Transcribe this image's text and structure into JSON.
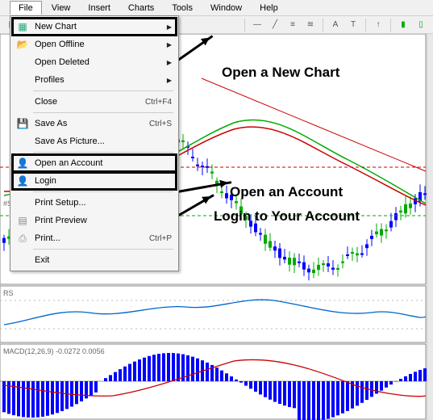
{
  "menubar": {
    "items": [
      "File",
      "View",
      "Insert",
      "Charts",
      "Tools",
      "Window",
      "Help"
    ],
    "active": 0
  },
  "file_menu": {
    "items": [
      {
        "label": "New Chart",
        "icon": "chart-plus",
        "submenu": true,
        "boxed": true
      },
      {
        "label": "Open Offline",
        "icon": "folder-open",
        "submenu": true
      },
      {
        "label": "Open Deleted",
        "submenu": true
      },
      {
        "label": "Profiles",
        "submenu": true
      },
      {
        "sep": true
      },
      {
        "label": "Close",
        "shortcut": "Ctrl+F4"
      },
      {
        "sep": true
      },
      {
        "label": "Save As",
        "icon": "save",
        "shortcut": "Ctrl+S"
      },
      {
        "label": "Save As Picture..."
      },
      {
        "sep": true
      },
      {
        "label": "Open an Account",
        "icon": "user-add",
        "boxed": true
      },
      {
        "label": "Login",
        "icon": "user-login",
        "boxed": true
      },
      {
        "sep": true
      },
      {
        "label": "Print Setup..."
      },
      {
        "label": "Print Preview",
        "icon": "print-preview"
      },
      {
        "label": "Print...",
        "icon": "print",
        "shortcut": "Ctrl+P"
      },
      {
        "sep": true
      },
      {
        "label": "Exit"
      }
    ]
  },
  "annotations": {
    "new_chart": "Open a New Chart",
    "open_account": "Open an Account",
    "login": "Login to Your Account"
  },
  "indicators": {
    "rsi_label": "RS",
    "macd_label": "MACD(12,26,9) -0.0272 0.0056",
    "symbol_label": "#S"
  },
  "chart_data": {
    "type": "candlestick_with_indicators",
    "title": "",
    "price_panel": {
      "trendline": {
        "type": "descending"
      },
      "horizontal_lines": [
        {
          "style": "dash",
          "color": "#c00",
          "y_rel": 0.62
        },
        {
          "style": "dash",
          "color": "#0a0",
          "y_rel": 0.82
        }
      ],
      "ma_fast_color": "#0a0",
      "ma_slow_color": "#c00"
    },
    "rsi_panel": {
      "line_color": "#06c"
    },
    "macd_panel": {
      "hist_color": "#00f",
      "signal_color": "#c00"
    }
  }
}
